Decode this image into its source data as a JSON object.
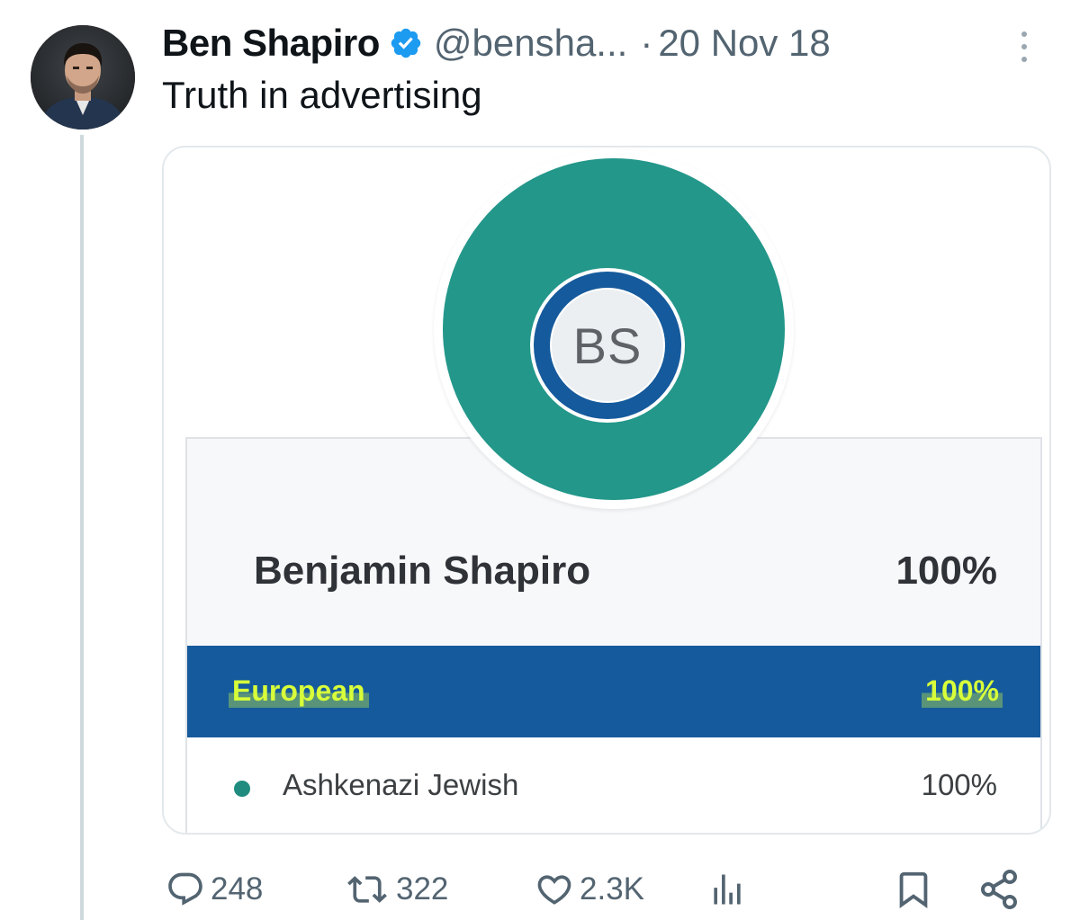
{
  "tweet": {
    "author": {
      "display_name": "Ben Shapiro",
      "handle": "@bensha...",
      "verified": true,
      "avatar_icon": "profile-photo"
    },
    "separator": "·",
    "date": "20 Nov 18",
    "text": "Truth in advertising",
    "media": {
      "initials": "BS",
      "donut_color": "#23978a",
      "ring_color": "#155a9c",
      "person": {
        "name": "Benjamin Shapiro",
        "percent": "100%"
      },
      "region": {
        "name": "European",
        "percent": "100%",
        "bar_color": "#155a9c",
        "highlight_color": "#d8ff39"
      },
      "population": {
        "name": "Ashkenazi Jewish",
        "percent": "100%",
        "dot_color": "#1f8c7f"
      }
    },
    "actions": {
      "replies": {
        "icon": "reply-icon",
        "count": "248"
      },
      "reposts": {
        "icon": "repost-icon",
        "count": "322"
      },
      "likes": {
        "icon": "like-icon",
        "count": "2.3K"
      },
      "views": {
        "icon": "analytics-icon"
      },
      "bookmark": {
        "icon": "bookmark-icon"
      },
      "share": {
        "icon": "share-icon"
      }
    }
  }
}
